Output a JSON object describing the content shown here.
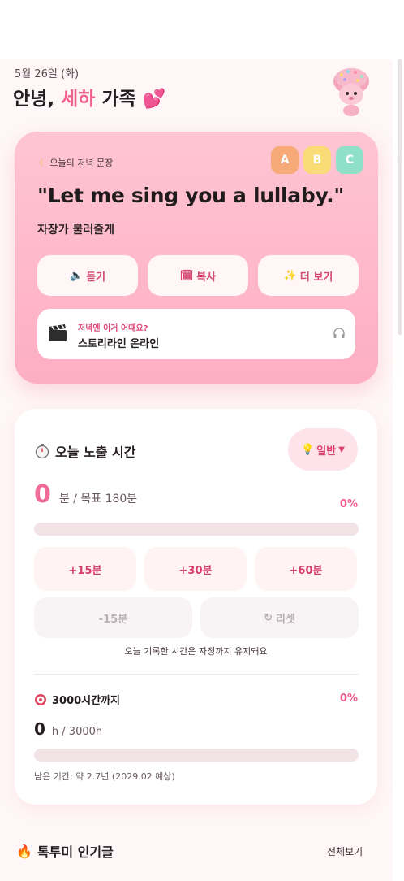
{
  "header": {
    "date": "5월 26일 (화)",
    "greeting_prefix": "안녕, ",
    "greeting_name": "세하",
    "greeting_suffix": " 가족 ",
    "greeting_emoji": "💕"
  },
  "hero": {
    "label_icon": "moon-icon",
    "label": "오늘의 저녁 문장",
    "badges": [
      {
        "letter": "A",
        "color": "#f8a978"
      },
      {
        "letter": "B",
        "color": "#f9dc75"
      },
      {
        "letter": "C",
        "color": "#8fe0c8"
      }
    ],
    "sentence": "\"Let me sing you a lullaby.\"",
    "translation": "자장가 불러줄게",
    "buttons": [
      {
        "icon": "🔈",
        "label": "듣기"
      },
      {
        "icon": "🗓",
        "label": "복사"
      },
      {
        "icon": "✨",
        "label": "더 보기"
      }
    ],
    "suggestion": {
      "small": "저녁엔 이거 어때요?",
      "title": "스토리라인 온라인"
    }
  },
  "timer": {
    "title": "오늘 노출 시간",
    "mode_label": "일반",
    "minutes": "0",
    "goal_text": "분 / 목표 180분",
    "percent_text": "0%",
    "progress": 0,
    "add_buttons": [
      "+15분",
      "+30분",
      "+60분"
    ],
    "sub_buttons": [
      {
        "icon": "",
        "label": "-15분"
      },
      {
        "icon": "↻",
        "label": "리셋"
      }
    ],
    "note": "오늘 기록한 시간은 자정까지 유지돼요",
    "long_goal": {
      "title": "3000시간까지",
      "percent_text": "0%",
      "hours": "0",
      "unit": "h / 3000h",
      "progress": 0,
      "remaining": "남은 기간: 약 2.7년 (2029.02 예상)"
    }
  },
  "popular": {
    "title": "톡투미 인기글",
    "see_all": "전체보기"
  },
  "colors": {
    "accent": "#f06b95",
    "hero_bg": "#ffc5d3"
  }
}
